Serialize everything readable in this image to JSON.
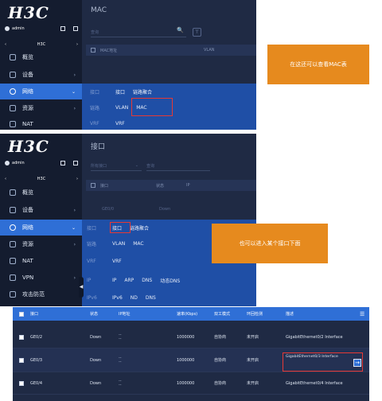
{
  "panel1": {
    "logo": "H3C",
    "user": "admin",
    "device": "H3C",
    "nav": [
      {
        "label": "概览"
      },
      {
        "label": "设备"
      },
      {
        "label": "网络"
      },
      {
        "label": "资源"
      },
      {
        "label": "NAT"
      }
    ],
    "main_title": "MAC",
    "search_placeholder": "查询",
    "filter_icon_glyph": "⊤",
    "search_icon_glyph": "🔍",
    "columns": [
      "MAC地址",
      "VLAN"
    ],
    "submenu": [
      {
        "category": "接口",
        "items": [
          "接口",
          "链路聚合"
        ]
      },
      {
        "category": "链路",
        "items": [
          "VLAN",
          "MAC"
        ]
      },
      {
        "category": "VRF",
        "items": [
          "VRF"
        ]
      }
    ],
    "callout": "在这还可以查看MAC表"
  },
  "panel2": {
    "logo": "H3C",
    "user": "admin",
    "device": "H3C",
    "nav": [
      {
        "label": "概览"
      },
      {
        "label": "设备"
      },
      {
        "label": "网络"
      },
      {
        "label": "资源"
      },
      {
        "label": "NAT"
      },
      {
        "label": "VPN"
      },
      {
        "label": "攻击防范"
      }
    ],
    "main_title": "接口",
    "select_placeholder": "所有接口",
    "search_placeholder": "查询",
    "columns": [
      "接口",
      "状态",
      "IP"
    ],
    "bg_row": [
      "GE0/0",
      "Down"
    ],
    "submenu": [
      {
        "category": "接口",
        "items": [
          "接口",
          "链路聚合"
        ]
      },
      {
        "category": "链路",
        "items": [
          "VLAN",
          "MAC"
        ]
      },
      {
        "category": "VRF",
        "items": [
          "VRF"
        ]
      },
      {
        "category": "IP",
        "items": [
          "IP",
          "ARP",
          "DNS",
          "动态DNS"
        ]
      },
      {
        "category": "IPv6",
        "items": [
          "IPv6",
          "ND",
          "DNS"
        ]
      }
    ],
    "callout": "也可以进入某个接口下面",
    "collapse_glyph": "◀"
  },
  "panel3": {
    "columns": [
      "接口",
      "状态",
      "IP地址",
      "速率(Kbps)",
      "双工模式",
      "环回检测",
      "描述"
    ],
    "menu_glyph": "☰",
    "rows": [
      {
        "port": "GE0/2",
        "status": "Down",
        "ip": "--",
        "speed": "1000000",
        "duplex": "自协商",
        "loop": "未开启",
        "desc": "GigabitEthernet0/2 Interface"
      },
      {
        "port": "GE0/3",
        "status": "Down",
        "ip": "--",
        "speed": "1000000",
        "duplex": "自协商",
        "loop": "未开启",
        "desc": "GigabitEthernet0/3 Interface"
      },
      {
        "port": "GE0/4",
        "status": "Down",
        "ip": "--",
        "speed": "1000000",
        "duplex": "自协商",
        "loop": "未开启",
        "desc": "GigabitEthernet0/4 Interface"
      }
    ],
    "go_glyph": "→"
  }
}
